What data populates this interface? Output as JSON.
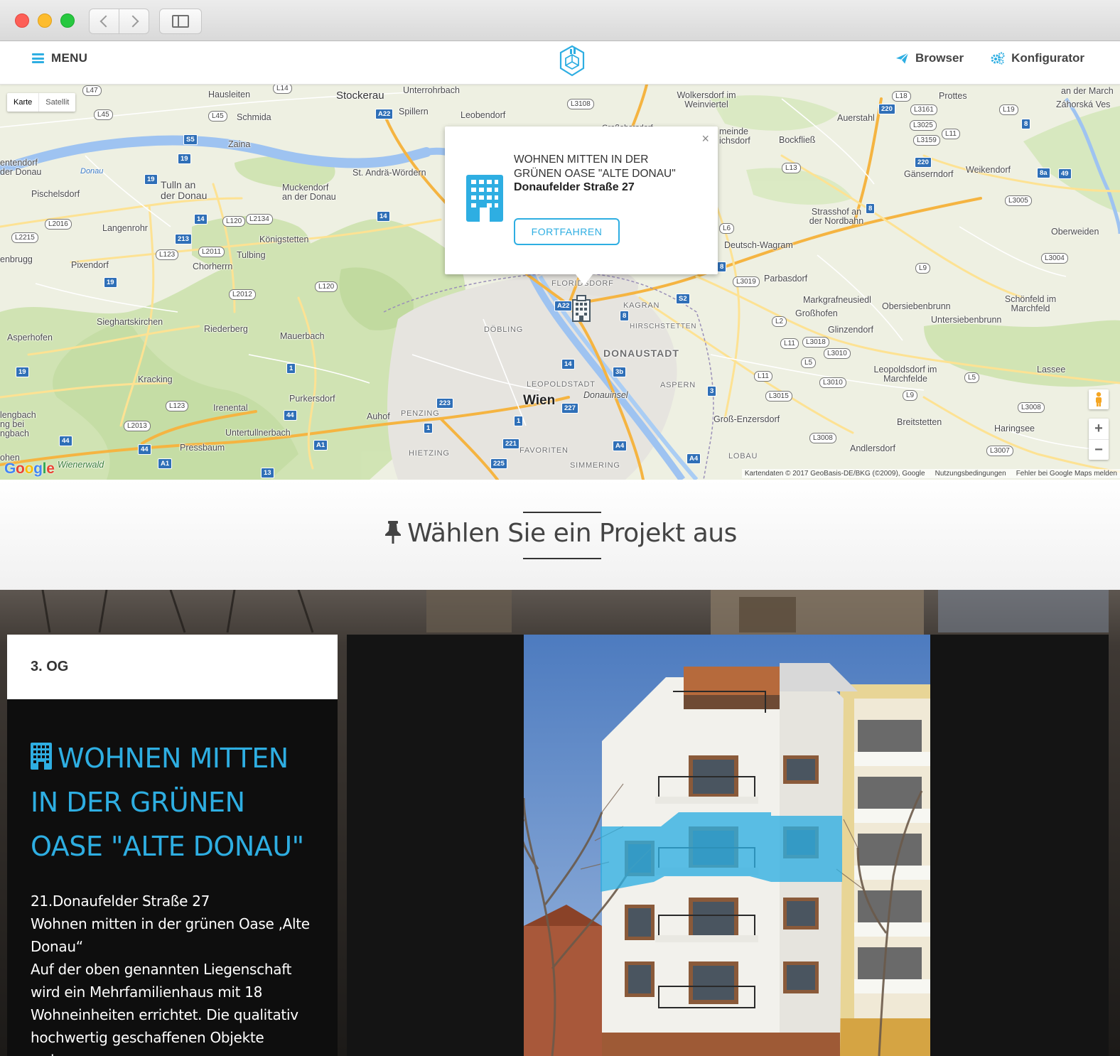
{
  "chrome": {
    "back_icon": "chevron-left-icon",
    "forward_icon": "chevron-right-icon",
    "sidebar_icon": "sidebar-icon"
  },
  "header": {
    "menu_label": "MENU",
    "nav": [
      {
        "label": "Browser",
        "icon": "paper-plane-icon"
      },
      {
        "label": "Konfigurator",
        "icon": "gears-icon"
      }
    ],
    "accent": "#2eaee2"
  },
  "map": {
    "type_options": [
      "Karte",
      "Satellit"
    ],
    "selected_type": "Karte",
    "info_window": {
      "title": "WOHNEN MITTEN IN DER GRÜNEN OASE \"ALTE DONAU\"",
      "address": "Donaufelder Straße 27",
      "button_label": "FORTFAHREN"
    },
    "attribution": {
      "data": "Kartendaten © 2017 GeoBasis-DE/BKG (©2009), Google",
      "terms": "Nutzungsbedingungen",
      "report": "Fehler bei Google Maps melden"
    },
    "labels": {
      "hausleiten": "Hausleiten",
      "stockerau": "Stockerau",
      "unterrohrbach": "Unterrohrbach",
      "spillern": "Spillern",
      "leobendorf": "Leobendorf",
      "schmida": "Schmida",
      "zaina": "Zaina",
      "tulln": "Tulln an der Donau",
      "st_andrae": "St. Andrä-Wördern",
      "muckendorf": "Muckendorf an der Donau",
      "pischelsdorf": "Pischelsdorf",
      "langenrohr": "Langenrohr",
      "koenigstetten": "Königstetten",
      "tulbing": "Tulbing",
      "chorherrn": "Chorherrn",
      "pixendorf": "Pixendorf",
      "enbrugg": "enbrugg",
      "sieghartskirchen": "Sieghartskirchen",
      "riederberg": "Riederberg",
      "mauerbach": "Mauerbach",
      "asperhofen": "Asperhofen",
      "kracking": "Kracking",
      "purkersdorf": "Purkersdorf",
      "irenental": "Irenental",
      "untertullnerbach": "Untertullnerbach",
      "pressbaum": "Pressbaum",
      "wienerwald": "Wienerwald",
      "auhof": "Auhof",
      "penzing": "PENZING",
      "hietzing": "HIETZING",
      "favoriten": "FAVORITEN",
      "simmering": "SIMMERING",
      "wien": "Wien",
      "leopoldstadt": "LEOPOLDSTADT",
      "donauinsel": "Donauinsel",
      "donaustadt": "DONAUSTADT",
      "aspern": "ASPERN",
      "doebling": "DÖBLING",
      "floridsdorf": "FLORIDSDORF",
      "kagran": "KAGRAN",
      "hirschstetten": "HIRSCHSTETTEN",
      "wolkersdorf": "Wolkersdorf im Weinviertel",
      "gemeinde": "meinde ichsdorf",
      "bockfliess": "Bockfließ",
      "aurstal": "Auerstahl",
      "prottes": "Prottes",
      "zahorska": "Záhorská Ves",
      "marchegg": "an der March",
      "gaenserndorf": "Gänserndorf",
      "weikendorf": "Weikendorf",
      "strasshof": "Strasshof an der Nordbahn",
      "oberweiden": "Oberweiden",
      "deutsch_wagram": "Deutsch-Wagram",
      "parbasdorf": "Parbasdorf",
      "markgrafneusiedl": "Markgrafneusiedl",
      "grosshofen": "Großhofen",
      "obersiebenbrunn": "Obersiebenbrunn",
      "untersiebenbrunn": "Untersiebenbrunn",
      "schoenfeld": "Schönfeld im Marchfeld",
      "glinzendorf": "Glinzendorf",
      "leopoldsdorf": "Leopoldsdorf im Marchfelde",
      "lassee": "Lassee",
      "gross_enzersdorf": "Groß-Enzersdorf",
      "breitstetten": "Breitstetten",
      "haringsee": "Haringsee",
      "andlersdorf": "Andlersdorf",
      "lobau": "LOBAU",
      "donau": "Donau",
      "enterdorf": "entendorf der Donau",
      "lengbach": "lengbach ng bei ngbach",
      "ohen": "ohen",
      "grossebersdorf": "Großebersdorf"
    }
  },
  "section": {
    "title": "Wählen Sie ein Projekt aus",
    "icon": "pushpin-icon"
  },
  "project": {
    "floor_label": "3. OG",
    "title": "WOHNEN MITTEN IN DER GRÜNEN OASE \"ALTE DONAU\"",
    "description_lines": [
      "21.Donaufelder Straße 27",
      "Wohnen mitten in der grünen Oase ‚Alte Donau“",
      "Auf der oben genannten Liegenschaft wird ein Mehrfamilienhaus mit 18 Wohneinheiten errichtet. Die qualitativ hochwertig geschaffenen Objekte weisen"
    ],
    "highlight_color": "#2eaee2"
  }
}
